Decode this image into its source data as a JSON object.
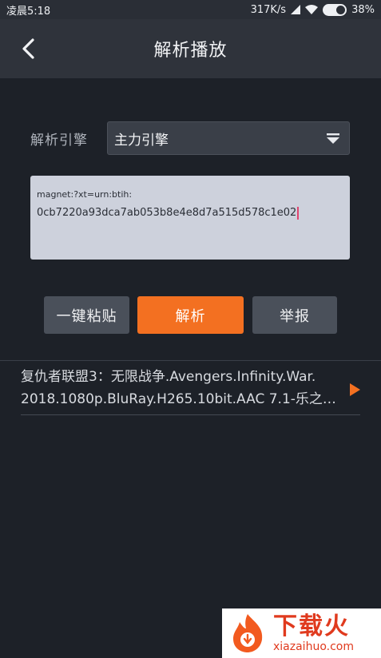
{
  "status_bar": {
    "time": "凌晨5:18",
    "net_speed": "317K/s",
    "battery": "38%"
  },
  "header": {
    "title": "解析播放",
    "back_icon": "chevron-left-icon"
  },
  "engine": {
    "label": "解析引擎",
    "selected": "主力引擎",
    "dropdown_icon": "caret-down-icon"
  },
  "link_input": {
    "line1": "magnet:?xt=urn:btih:",
    "line2": "0cb7220a93dca7ab053b8e4e8d7a515d578c1e02"
  },
  "buttons": {
    "paste": "一键粘贴",
    "parse": "解析",
    "report": "举报"
  },
  "result": {
    "line1": "复仇者联盟3：无限战争.Avengers.Infinity.War.",
    "line2": "2018.1080p.BluRay.H265.10bit.AAC 7.1-乐之…",
    "play_icon": "play-icon"
  },
  "watermark": {
    "title": "下载火",
    "url": "xiazaihuo.com"
  },
  "colors": {
    "accent": "#f37021",
    "background": "#1d2128",
    "header": "#2f333b"
  }
}
